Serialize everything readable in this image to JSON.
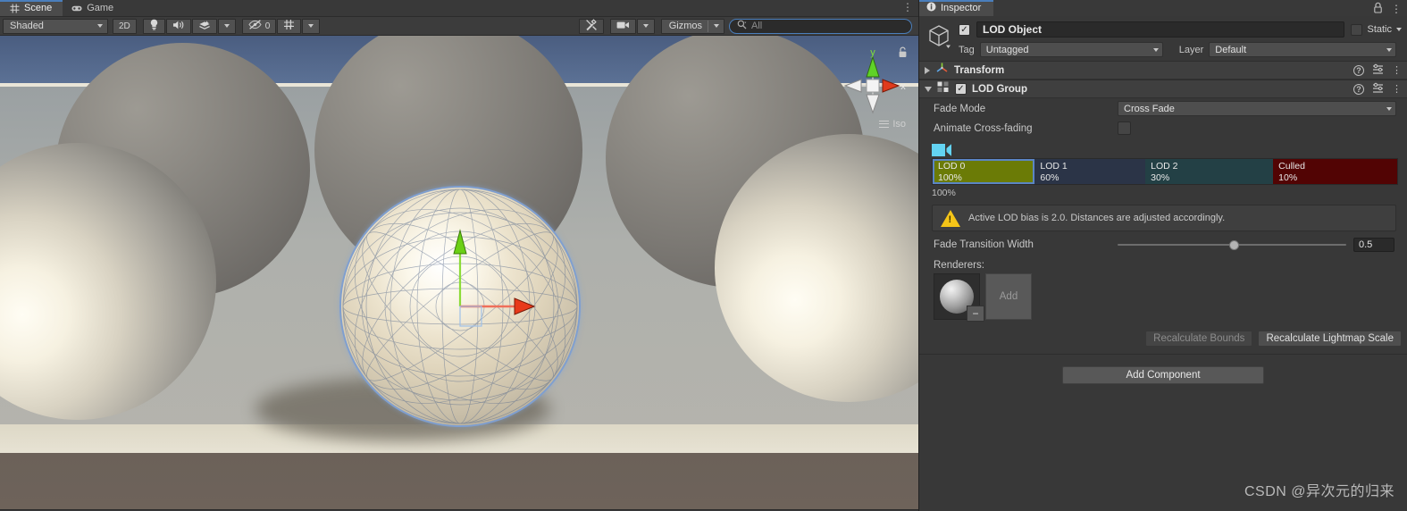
{
  "scene_panel": {
    "tabs": [
      {
        "label": "Scene",
        "icon": "grid-icon",
        "active": true
      },
      {
        "label": "Game",
        "icon": "gamepad-icon",
        "active": false
      }
    ],
    "tab_menu": "⋮",
    "toolbar": {
      "draw_mode": "Shaded",
      "mode_2d": "2D",
      "lighting_icon": "lightbulb-icon",
      "audio_icon": "speaker-icon",
      "effects_icon": "effects-icon",
      "hidden_count": "0",
      "hidden_icon": "eye-off-icon",
      "grid_icon": "grid-snap-icon",
      "tools_icon": "tools-icon",
      "camera_icon": "camera-icon",
      "gizmos_label": "Gizmos",
      "search_placeholder": "All",
      "search_value": "",
      "search_icon": "search-icon"
    },
    "viewport": {
      "orientation_label": "Iso",
      "axis_x": "x",
      "axis_y": "y",
      "lock_icon": "lock-icon",
      "menu_icon": "hamburger-icon"
    }
  },
  "inspector": {
    "tab": {
      "label": "Inspector",
      "icon": "info-icon"
    },
    "lock_icon": "lock-icon",
    "menu_icon": "kebab-menu-icon",
    "object": {
      "enabled": true,
      "name": "LOD Object",
      "static_label": "Static",
      "static_checked": false,
      "tag_label": "Tag",
      "tag_value": "Untagged",
      "layer_label": "Layer",
      "layer_value": "Default"
    },
    "components": [
      {
        "name": "Transform",
        "expanded": false,
        "has_toggle": false
      },
      {
        "name": "LOD Group",
        "expanded": true,
        "has_toggle": true,
        "enabled": true
      }
    ],
    "lod_group": {
      "fade_mode_label": "Fade Mode",
      "fade_mode_value": "Cross Fade",
      "animate_label": "Animate Cross-fading",
      "animate_checked": false,
      "camera_marker_icon": "camera-icon",
      "current_percent": "100%",
      "warning_icon": "warning-icon",
      "warning_text": "Active LOD bias is 2.0. Distances are adjusted accordingly.",
      "fade_width_label": "Fade Transition Width",
      "fade_width_value": "0.5",
      "fade_width_fraction": 0.5,
      "renderers_label": "Renderers:",
      "renderer_thumb_icon": "sphere-mesh-icon",
      "renderer_remove_label": "−",
      "add_label": "Add",
      "recalculate_bounds_label": "Recalculate Bounds",
      "recalculate_lightmap_label": "Recalculate Lightmap Scale"
    },
    "add_component_label": "Add Component"
  },
  "chart_data": {
    "type": "bar",
    "title": "LOD Group level distribution",
    "categories": [
      "LOD 0",
      "LOD 1",
      "LOD 2",
      "Culled"
    ],
    "values": [
      100,
      60,
      30,
      10
    ],
    "labels": [
      "100%",
      "60%",
      "30%",
      "10%"
    ],
    "widths_percent": [
      22.0,
      23.8,
      27.5,
      26.7
    ],
    "colors": [
      "#6b7b06",
      "#2b3447",
      "#234045",
      "#520404"
    ],
    "selected_index": 0,
    "selection_color": "#5b85c4",
    "xlabel": "",
    "ylabel": "",
    "legend": []
  },
  "watermark": "CSDN @异次元的归来"
}
